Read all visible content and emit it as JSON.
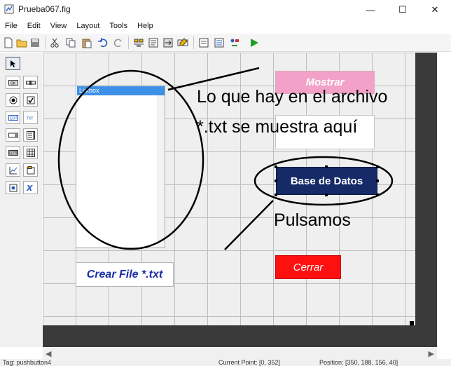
{
  "window": {
    "title": "Prueba067.fig",
    "minimize_glyph": "—",
    "maximize_glyph": "☐",
    "close_glyph": "✕"
  },
  "menu": [
    "File",
    "Edit",
    "View",
    "Layout",
    "Tools",
    "Help"
  ],
  "toolbar": {
    "icons": [
      "new-icon",
      "open-icon",
      "save-icon",
      "cut-icon",
      "copy-icon",
      "paste-icon",
      "undo-icon",
      "redo-icon",
      "align-icon",
      "menu-editor-icon",
      "tab-order-icon",
      "toolbar-editor-icon",
      "m-file-editor-icon",
      "property-inspector-icon",
      "object-browser-icon",
      "run-icon"
    ]
  },
  "palette": {
    "tools": [
      "select-tool",
      "push-button-tool",
      "slider-tool",
      "radio-button-tool",
      "checkbox-tool",
      "edit-text-tool",
      "static-text-tool",
      "popup-menu-tool",
      "listbox-tool",
      "toggle-button-tool",
      "table-tool",
      "axes-tool",
      "panel-tool",
      "button-group-tool",
      "activex-tool"
    ]
  },
  "canvas": {
    "listbox": {
      "selected_item": "Listbox"
    },
    "buttons": {
      "crear": "Crear File *.txt",
      "mostrar": "Mostrar",
      "base_datos": "Base de Datos",
      "cerrar": "Cerrar"
    }
  },
  "annotations": {
    "line1": "Lo que hay en el archivo",
    "line2": "*.txt se muestra aquí",
    "pulsamos": "Pulsamos"
  },
  "colors": {
    "mostrar_bg": "#f3a1c8",
    "base_datos_bg": "#162a68",
    "cerrar_bg": "#ff1010",
    "crear_text": "#1b2ea8"
  },
  "statusbar": {
    "tag": "Tag: pushbutton4",
    "current_point": "Current Point: [0, 352]",
    "position": "Position: [350, 188, 156, 40]"
  }
}
